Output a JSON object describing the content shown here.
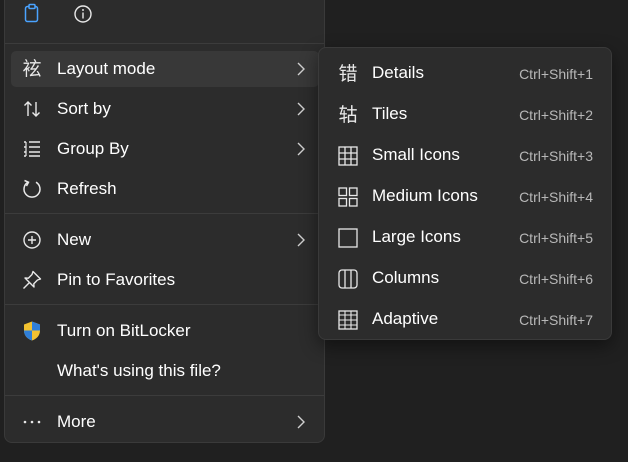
{
  "menu": {
    "top_icons": [
      {
        "name": "clipboard-icon"
      },
      {
        "name": "info-icon"
      }
    ],
    "items": [
      {
        "label": "Layout mode",
        "icon": "layout-mode-icon",
        "glyph": "袨",
        "has_submenu": true,
        "active": true
      },
      {
        "label": "Sort by",
        "icon": "sort-icon",
        "has_submenu": true
      },
      {
        "label": "Group By",
        "icon": "group-by-icon",
        "has_submenu": true
      },
      {
        "label": "Refresh",
        "icon": "refresh-icon",
        "has_submenu": false
      },
      {
        "label": "New",
        "icon": "new-icon",
        "has_submenu": true
      },
      {
        "label": "Pin to Favorites",
        "icon": "pin-icon",
        "has_submenu": false
      },
      {
        "label": "Turn on BitLocker",
        "icon": "shield-icon",
        "has_submenu": false
      },
      {
        "label": "What's using this file?",
        "icon": "",
        "has_submenu": false
      },
      {
        "label": "More",
        "icon": "more-icon",
        "glyph": "···",
        "has_submenu": true
      }
    ]
  },
  "submenu": {
    "items": [
      {
        "label": "Details",
        "shortcut": "Ctrl+Shift+1",
        "icon": "details-icon",
        "glyph": "错"
      },
      {
        "label": "Tiles",
        "shortcut": "Ctrl+Shift+2",
        "icon": "tiles-icon",
        "glyph": "轱"
      },
      {
        "label": "Small Icons",
        "shortcut": "Ctrl+Shift+3",
        "icon": "small-icons-icon"
      },
      {
        "label": "Medium Icons",
        "shortcut": "Ctrl+Shift+4",
        "icon": "medium-icons-icon"
      },
      {
        "label": "Large Icons",
        "shortcut": "Ctrl+Shift+5",
        "icon": "large-icons-icon"
      },
      {
        "label": "Columns",
        "shortcut": "Ctrl+Shift+6",
        "icon": "columns-icon"
      },
      {
        "label": "Adaptive",
        "shortcut": "Ctrl+Shift+7",
        "icon": "adaptive-icon"
      }
    ]
  },
  "colors": {
    "menu_bg": "#2c2c2c",
    "highlight": "#383838",
    "text": "#ffffff",
    "shortcut_text": "#b8b8b8",
    "shield_blue": "#2f7fd8",
    "shield_yellow": "#f2c230"
  }
}
